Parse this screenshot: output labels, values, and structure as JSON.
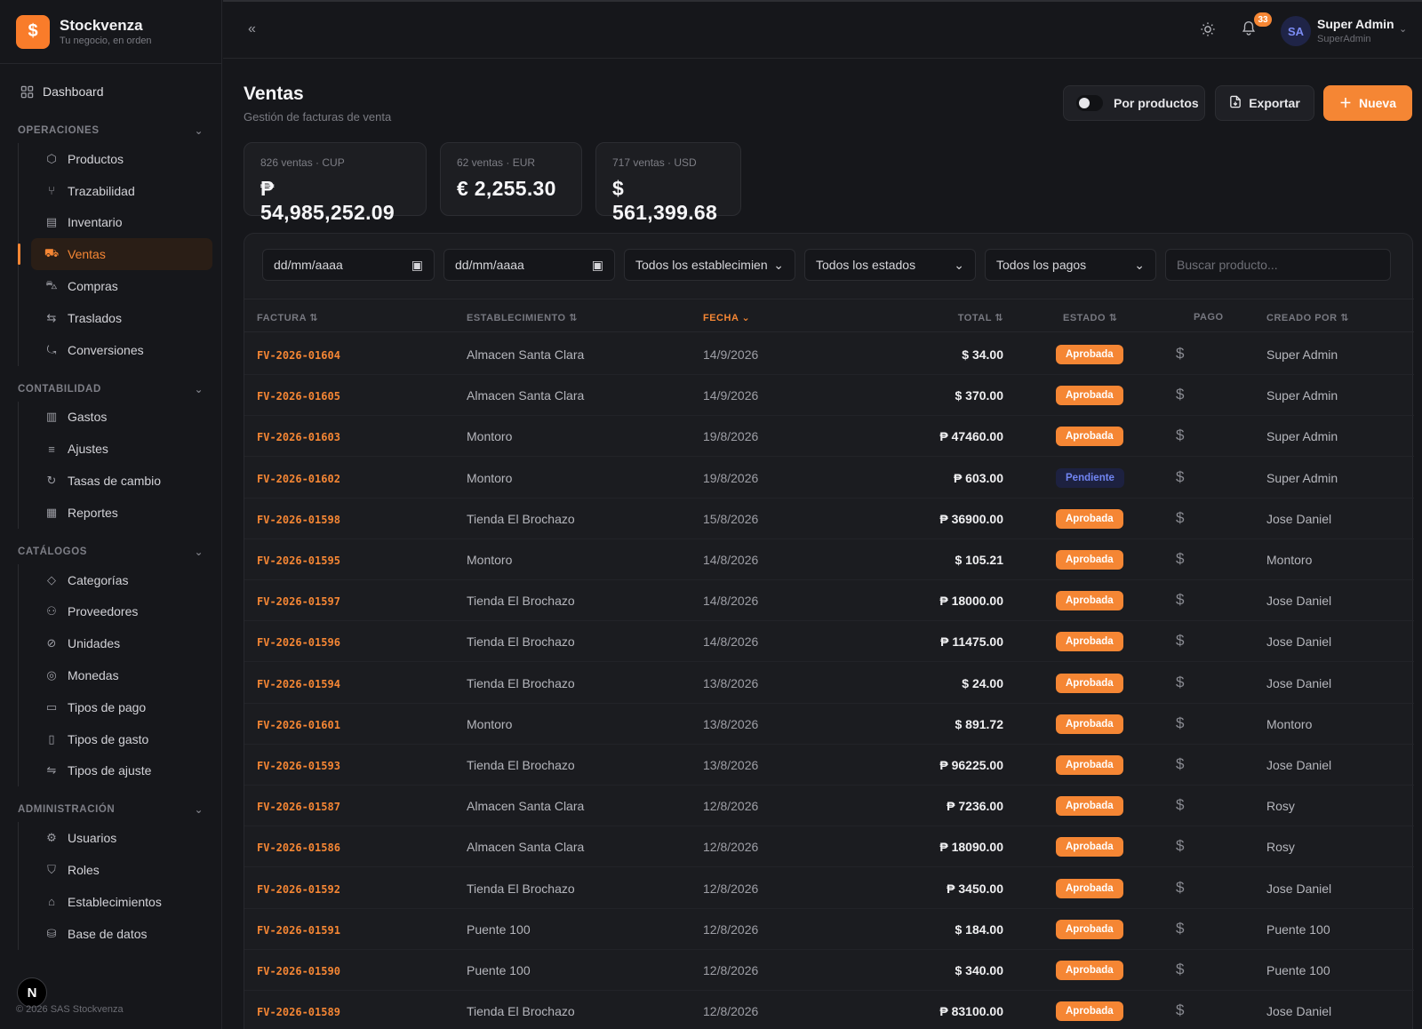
{
  "brand": {
    "name": "Stockvenza",
    "tagline": "Tu negocio, en orden",
    "logo_icon": "dollar-icon"
  },
  "nav": {
    "dashboard": "Dashboard",
    "sections": [
      {
        "title": "OPERACIONES",
        "items": [
          "Productos",
          "Trazabilidad",
          "Inventario",
          "Ventas",
          "Compras",
          "Traslados",
          "Conversiones"
        ]
      },
      {
        "title": "CONTABILIDAD",
        "items": [
          "Gastos",
          "Ajustes",
          "Tasas de cambio",
          "Reportes"
        ]
      },
      {
        "title": "CATÁLOGOS",
        "items": [
          "Categorías",
          "Proveedores",
          "Unidades",
          "Monedas",
          "Tipos de pago",
          "Tipos de gasto",
          "Tipos de ajuste"
        ]
      },
      {
        "title": "ADMINISTRACIÓN",
        "items": [
          "Usuarios",
          "Roles",
          "Establecimientos",
          "Base de datos"
        ]
      }
    ],
    "active_item": "Ventas"
  },
  "footer": {
    "copyright": "© 2026 SAS Stockvenza",
    "badge": "N"
  },
  "topbar": {
    "notifications_count": "33",
    "user_initials": "SA",
    "user_name": "Super Admin",
    "user_role": "SuperAdmin"
  },
  "page": {
    "title": "Ventas",
    "subtitle": "Gestión de facturas de venta",
    "toggle_label": "Por productos",
    "export_label": "Exportar",
    "new_label": "Nueva"
  },
  "summary_cards": [
    {
      "label": "826 ventas · CUP",
      "value": "₱ 54,985,252.09"
    },
    {
      "label": "62 ventas · EUR",
      "value": "€ 2,255.30"
    },
    {
      "label": "717 ventas · USD",
      "value": "$ 561,399.68"
    }
  ],
  "filters": {
    "date_from": "dd/mm/aaaa",
    "date_to": "dd/mm/aaaa",
    "establishment": "Todos los establecimien",
    "status": "Todos los estados",
    "payment": "Todos los pagos",
    "search_placeholder": "Buscar producto..."
  },
  "table": {
    "headers": [
      "FACTURA",
      "ESTABLECIMIENTO",
      "FECHA",
      "TOTAL",
      "ESTADO",
      "PAGO",
      "CREADO POR"
    ],
    "sorted_column": "FECHA",
    "rows": [
      {
        "factura": "FV-2026-01604",
        "establecimiento": "Almacen Santa Clara",
        "fecha": "14/9/2026",
        "total": "$ 34.00",
        "estado": "Aprobada",
        "pago": "$",
        "creado": "Super Admin"
      },
      {
        "factura": "FV-2026-01605",
        "establecimiento": "Almacen Santa Clara",
        "fecha": "14/9/2026",
        "total": "$ 370.00",
        "estado": "Aprobada",
        "pago": "$",
        "creado": "Super Admin"
      },
      {
        "factura": "FV-2026-01603",
        "establecimiento": "Montoro",
        "fecha": "19/8/2026",
        "total": "₱ 47460.00",
        "estado": "Aprobada",
        "pago": "$",
        "creado": "Super Admin"
      },
      {
        "factura": "FV-2026-01602",
        "establecimiento": "Montoro",
        "fecha": "19/8/2026",
        "total": "₱ 603.00",
        "estado": "Pendiente",
        "pago": "$",
        "creado": "Super Admin"
      },
      {
        "factura": "FV-2026-01598",
        "establecimiento": "Tienda El Brochazo",
        "fecha": "15/8/2026",
        "total": "₱ 36900.00",
        "estado": "Aprobada",
        "pago": "$",
        "creado": "Jose Daniel"
      },
      {
        "factura": "FV-2026-01595",
        "establecimiento": "Montoro",
        "fecha": "14/8/2026",
        "total": "$ 105.21",
        "estado": "Aprobada",
        "pago": "$",
        "creado": "Montoro"
      },
      {
        "factura": "FV-2026-01597",
        "establecimiento": "Tienda El Brochazo",
        "fecha": "14/8/2026",
        "total": "₱ 18000.00",
        "estado": "Aprobada",
        "pago": "$",
        "creado": "Jose Daniel"
      },
      {
        "factura": "FV-2026-01596",
        "establecimiento": "Tienda El Brochazo",
        "fecha": "14/8/2026",
        "total": "₱ 11475.00",
        "estado": "Aprobada",
        "pago": "$",
        "creado": "Jose Daniel"
      },
      {
        "factura": "FV-2026-01594",
        "establecimiento": "Tienda El Brochazo",
        "fecha": "13/8/2026",
        "total": "$ 24.00",
        "estado": "Aprobada",
        "pago": "$",
        "creado": "Jose Daniel"
      },
      {
        "factura": "FV-2026-01601",
        "establecimiento": "Montoro",
        "fecha": "13/8/2026",
        "total": "$ 891.72",
        "estado": "Aprobada",
        "pago": "$",
        "creado": "Montoro"
      },
      {
        "factura": "FV-2026-01593",
        "establecimiento": "Tienda El Brochazo",
        "fecha": "13/8/2026",
        "total": "₱ 96225.00",
        "estado": "Aprobada",
        "pago": "$",
        "creado": "Jose Daniel"
      },
      {
        "factura": "FV-2026-01587",
        "establecimiento": "Almacen Santa Clara",
        "fecha": "12/8/2026",
        "total": "₱ 7236.00",
        "estado": "Aprobada",
        "pago": "$",
        "creado": "Rosy"
      },
      {
        "factura": "FV-2026-01586",
        "establecimiento": "Almacen Santa Clara",
        "fecha": "12/8/2026",
        "total": "₱ 18090.00",
        "estado": "Aprobada",
        "pago": "$",
        "creado": "Rosy"
      },
      {
        "factura": "FV-2026-01592",
        "establecimiento": "Tienda El Brochazo",
        "fecha": "12/8/2026",
        "total": "₱ 3450.00",
        "estado": "Aprobada",
        "pago": "$",
        "creado": "Jose Daniel"
      },
      {
        "factura": "FV-2026-01591",
        "establecimiento": "Puente 100",
        "fecha": "12/8/2026",
        "total": "$ 184.00",
        "estado": "Aprobada",
        "pago": "$",
        "creado": "Puente 100"
      },
      {
        "factura": "FV-2026-01590",
        "establecimiento": "Puente 100",
        "fecha": "12/8/2026",
        "total": "$ 340.00",
        "estado": "Aprobada",
        "pago": "$",
        "creado": "Puente 100"
      },
      {
        "factura": "FV-2026-01589",
        "establecimiento": "Tienda El Brochazo",
        "fecha": "12/8/2026",
        "total": "₱ 83100.00",
        "estado": "Aprobada",
        "pago": "$",
        "creado": "Jose Daniel"
      }
    ]
  },
  "colors": {
    "accent": "#f58634",
    "background": "#16171b",
    "panel": "#1b1c20",
    "pending": "#7185f2"
  }
}
